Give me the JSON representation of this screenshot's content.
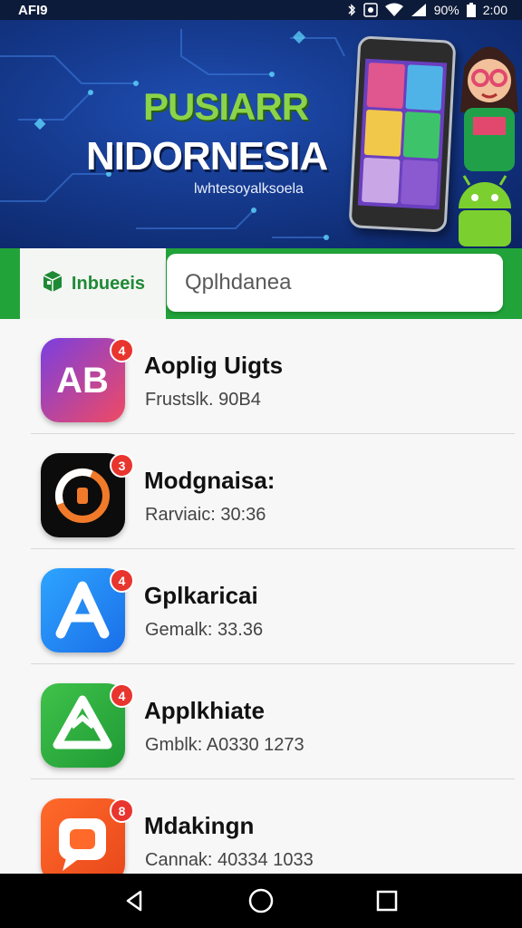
{
  "status_bar": {
    "carrier": "AFI9",
    "battery": "90%",
    "time": "2:00"
  },
  "banner": {
    "title_line1": "PUSIARR",
    "title_line2": "NIDORNESIA",
    "subtitle": "lwhtesoyalksoela"
  },
  "category_tab": {
    "label": "Inbueeis",
    "icon": "store-box-icon"
  },
  "search": {
    "placeholder": "Qplhdanea"
  },
  "apps": [
    {
      "name": "Aoplig Uigts",
      "meta": "Frustslk. 90B4",
      "badge": "4",
      "icon": "ab-letters-icon",
      "color_from": "#7a3fe0",
      "color_to": "#f04a63"
    },
    {
      "name": "Modgnaisa:",
      "meta": "Rarviaic: 30:36",
      "badge": "3",
      "icon": "ring-logo-icon",
      "color_from": "#0a0a0a",
      "color_to": "#1b1b1b"
    },
    {
      "name": "Gplkaricai",
      "meta": "Gemalk: 33.36",
      "badge": "4",
      "icon": "letter-a-icon",
      "color_from": "#2ea4ff",
      "color_to": "#1a6fe8"
    },
    {
      "name": "Applkhiate",
      "meta": "Gmblk: A0330 1273",
      "badge": "4",
      "icon": "recycle-triangle-icon",
      "color_from": "#3fc24a",
      "color_to": "#1f9a35"
    },
    {
      "name": "Mdakingn",
      "meta": "Cannak: 40334 1033",
      "badge": "8",
      "icon": "chat-bubble-icon",
      "color_from": "#ff6a2a",
      "color_to": "#e8471a"
    }
  ],
  "nav": {
    "back": "back-icon",
    "home": "home-icon",
    "recents": "recents-icon"
  },
  "colors": {
    "banner_blue": "#15398c",
    "accent_green": "#22a33a",
    "title_green": "#8bd44a",
    "badge_red": "#e8352e"
  }
}
